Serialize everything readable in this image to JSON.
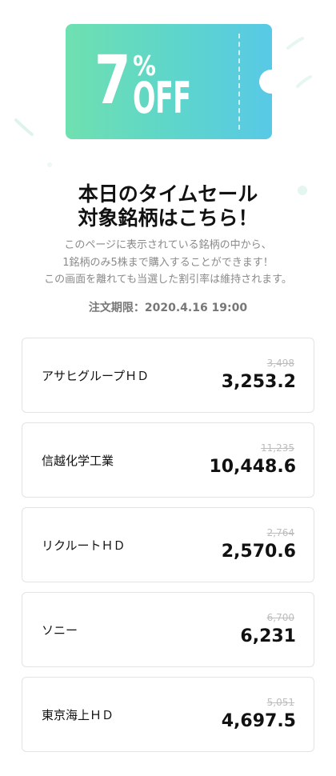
{
  "coupon": {
    "percent": "7",
    "percent_sign": "%",
    "off": "OFF"
  },
  "headline": {
    "line1": "本日のタイムセール",
    "line2": "対象銘柄はこちら！"
  },
  "description": {
    "line1": "このページに表示されている銘柄の中から、",
    "line2": "1銘柄のみ5株まで購入することができます！",
    "line3": "この画面を離れても当選した割引率は維持されます。"
  },
  "deadline": "注文期限：2020.4.16 19:00",
  "stocks": [
    {
      "name": "アサヒグループＨＤ",
      "original": "3,498",
      "price": "3,253.2"
    },
    {
      "name": "信越化学工業",
      "original": "11,235",
      "price": "10,448.6"
    },
    {
      "name": "リクルートＨＤ",
      "original": "2,764",
      "price": "2,570.6"
    },
    {
      "name": "ソニー",
      "original": "6,700",
      "price": "6,231"
    },
    {
      "name": "東京海上ＨＤ",
      "original": "5,051",
      "price": "4,697.5"
    }
  ],
  "colors": {
    "ticket_start": "#6fe0b0",
    "ticket_end": "#58c9e6",
    "strike_gray": "#bdbdbd"
  }
}
